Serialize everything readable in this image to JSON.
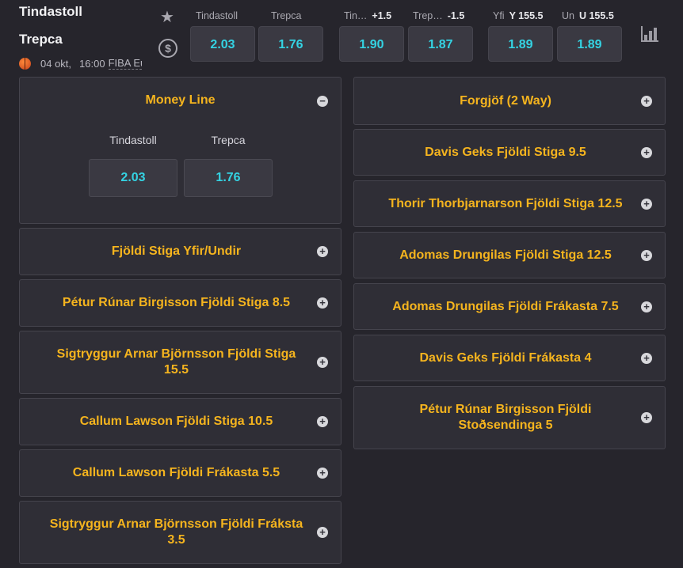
{
  "match": {
    "team1": "Tindastoll",
    "team2": "Trepca",
    "date": "04 okt,",
    "time": "16:00",
    "league": "FIBA Eu"
  },
  "icons": {
    "favorite": "star-icon",
    "cashout": "dollar-icon",
    "stats": "bar-chart-icon",
    "sport": "basketball-icon"
  },
  "header_markets": [
    {
      "name": "Tindastoll",
      "line": "",
      "odd": "2.03"
    },
    {
      "name": "Trepca",
      "line": "",
      "odd": "1.76"
    },
    {
      "name": "Tin…",
      "line": "+1.5",
      "odd": "1.90"
    },
    {
      "name": "Trep…",
      "line": "-1.5",
      "odd": "1.87"
    },
    {
      "name": "Yfi",
      "line": "Y 155.5",
      "odd": "1.89"
    },
    {
      "name": "Un",
      "line": "U 155.5",
      "odd": "1.89"
    }
  ],
  "money_line": {
    "title": "Money Line",
    "toggle": "−",
    "options": [
      {
        "label": "Tindastoll",
        "odd": "2.03"
      },
      {
        "label": "Trepca",
        "odd": "1.76"
      }
    ]
  },
  "left_markets": [
    "Fjöldi Stiga Yfir/Undir",
    "Pétur Rúnar Birgisson Fjöldi Stiga 8.5",
    "Sigtryggur Arnar Björnsson Fjöldi Stiga 15.5",
    "Callum Lawson Fjöldi Stiga 10.5",
    "Callum Lawson Fjöldi Frákasta 5.5",
    "Sigtryggur Arnar Björnsson Fjöldi Fráksta 3.5"
  ],
  "right_markets": [
    "Forgjöf (2 Way)",
    "Davis Geks Fjöldi Stiga 9.5",
    "Thorir Thorbjarnarson Fjöldi Stiga 12.5",
    "Adomas Drungilas Fjöldi Stiga 12.5",
    "Adomas Drungilas Fjöldi Frákasta 7.5",
    "Davis Geks Fjöldi Frákasta 4",
    "Pétur Rúnar Birgisson Fjöldi Stoðsendinga 5"
  ],
  "expand_symbol": "+",
  "colors": {
    "background": "#26252c",
    "card": "#2f2e36",
    "accent": "#f5b41e",
    "odd_text": "#34d3e3"
  }
}
